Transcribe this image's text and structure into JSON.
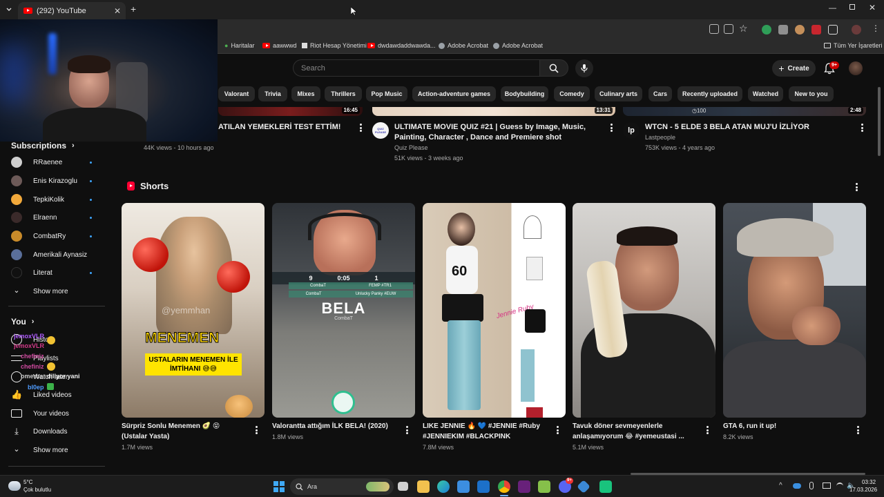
{
  "browser": {
    "tab_title": "(292) YouTube",
    "new_tab": "+",
    "bookmarks": [
      "Haritalar",
      "aawwwd",
      "Riot Hesap Yönetimi",
      "dwdawdaddwawda...",
      "Adobe Acrobat",
      "Adobe Acrobat"
    ],
    "all_bookmarks": "Tüm Yer İşaretleri"
  },
  "header": {
    "search_placeholder": "Search",
    "create_label": "Create",
    "notification_count": "9+"
  },
  "chips": [
    "Valorant",
    "Trivia",
    "Mixes",
    "Thrillers",
    "Pop Music",
    "Action-adventure games",
    "Bodybuilding",
    "Comedy",
    "Culinary arts",
    "Cars",
    "Recently uploaded",
    "Watched",
    "New to you"
  ],
  "sidebar": {
    "subscriptions_title": "Subscriptions",
    "subscriptions": [
      "RRaenee",
      "Enis Kirazoglu",
      "TepkiKolik",
      "Elraenn",
      "CombatRy",
      "Amerikali Aynasiz",
      "Literat"
    ],
    "show_more": "Show more",
    "you_title": "You",
    "you_items": [
      "History",
      "Playlists",
      "Watch later",
      "Liked videos",
      "Your videos",
      "Downloads"
    ],
    "show_more_2": "Show more"
  },
  "overlay_chat": [
    {
      "name": "jemoxVLR",
      "color": "#b05cff"
    },
    {
      "name": "jemoxVLR",
      "color": "#d43a8a"
    },
    {
      "name": "chefiniz",
      "color": "#d14aa0"
    },
    {
      "name": "chefiniz",
      "color": "#d14aa0"
    },
    {
      "name": "omerbsr",
      "color": "#c9c9c9"
    },
    {
      "name": "bl0ep",
      "color": "#4f9cff"
    }
  ],
  "overlay_extra_text": "diliyor yani",
  "top_videos": [
    {
      "title": "ATILAN YEMEKLERİ TEST ETTİM!",
      "meta": "44K views - 10 hours ago",
      "duration": "16:45"
    },
    {
      "title": "ULTIMATE MOVIE QUIZ #21 | Guess by Image, Music, Painting, Character , Dance and Premiere shot",
      "channel": "Quiz Please",
      "meta": "51K views - 3 weeks ago",
      "duration": "13:31",
      "channel_badge": "QUIZ PLEASE"
    },
    {
      "title": "WTCN - 5 ELDE 3 BELA ATAN MUJ'U İZLİYOR",
      "channel": "Lastpeople",
      "meta": "753K views - 4 years ago",
      "duration": "2:48",
      "channel_badge": "lp"
    }
  ],
  "shorts": {
    "title": "Shorts",
    "items": [
      {
        "title": "Sürpriz Sonlu Menemen 🥑 😝 (Ustalar Yasta)",
        "views": "1.7M views",
        "overlay_big": "MENEMEN",
        "overlay_small": "USTALARIN MENEMEN İLE İMTİHANI 😅😅",
        "handle": "@yemmhan"
      },
      {
        "title": "Valorantta attığım İLK BELA! (2020)",
        "views": "1.8M views",
        "overlay_big": "BELA",
        "overlay_small": "CombaT",
        "hud": [
          "9",
          "0:05",
          "1"
        ],
        "hud_names": [
          "CombaT",
          "FEMP #TR1",
          "CombaT",
          "Unlucky Panky #EUW"
        ]
      },
      {
        "title": "LIKE JENNIE 🔥 💙 #JENNIE #Ruby #JENNIEKIM #BLACKPINK",
        "views": "7.8M views",
        "overlay_big": "60",
        "overlay_small": "Jennie Ruby"
      },
      {
        "title": "Tavuk döner sevmeyenlerle anlaşamıyorum 😂 #yemeustasi ...",
        "views": "5.1M views"
      },
      {
        "title": "GTA 6, run it up!",
        "views": "8.2K views"
      }
    ]
  },
  "taskbar": {
    "weather_temp": "5°C",
    "weather_desc": "Çok bulutlu",
    "search_label": "Ara",
    "time": "03:32",
    "date": "17.03.2026",
    "discord_badge": "9+"
  },
  "colors": {
    "accent_red": "#ff0000",
    "page_bg": "#0f0f0f",
    "chip_bg": "#272727",
    "link_blue": "#3ea6ff"
  }
}
